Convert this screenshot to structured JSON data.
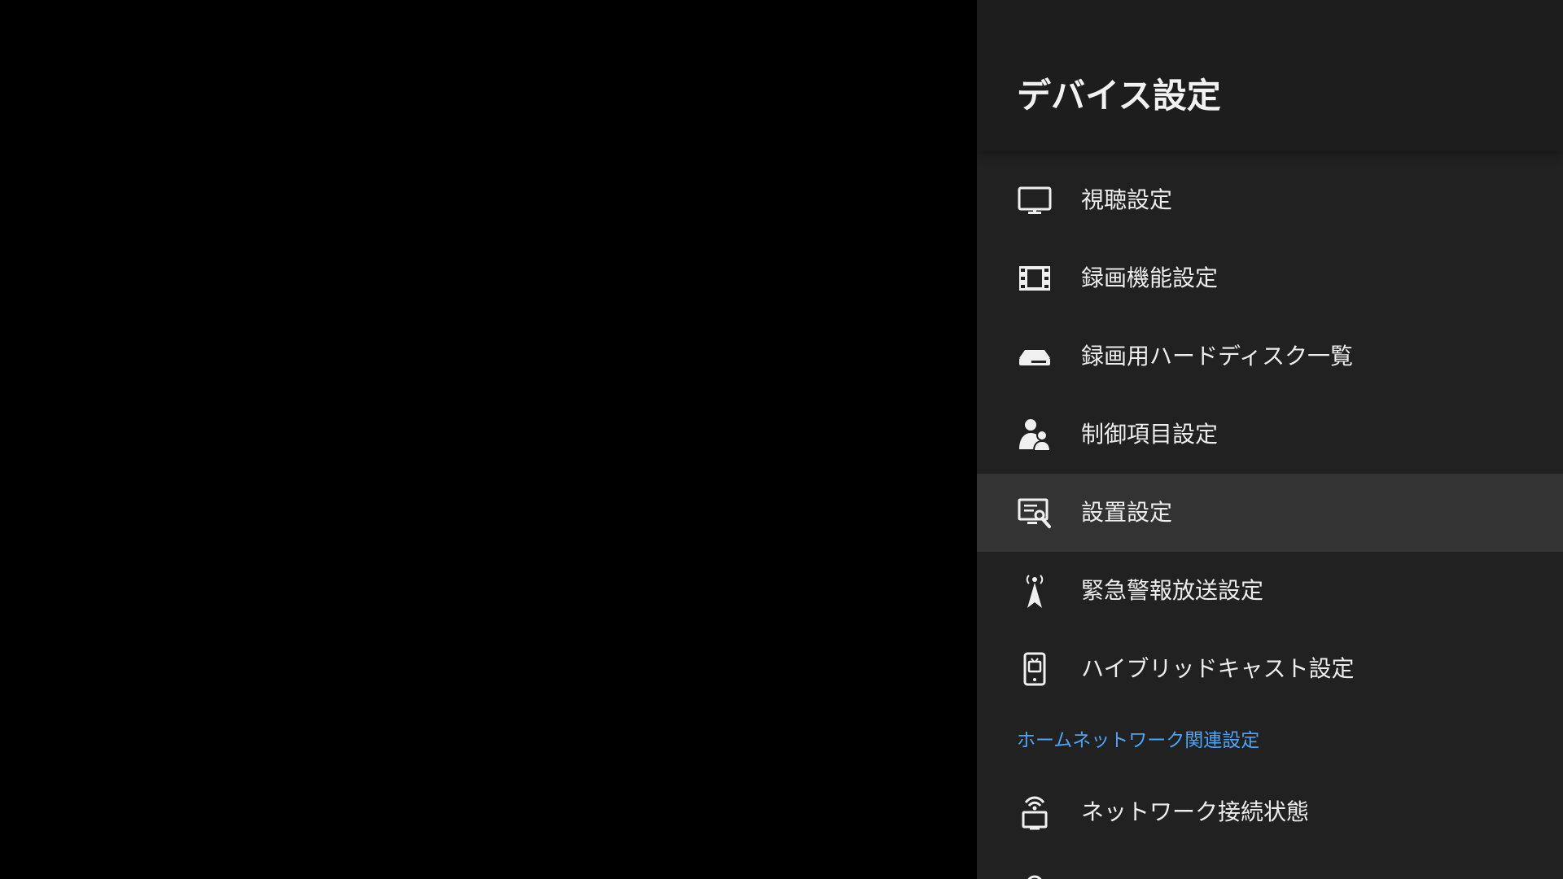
{
  "panel": {
    "title": "デバイス設定"
  },
  "menu": {
    "items": [
      {
        "label": "視聴設定",
        "icon": "tv-monitor-icon"
      },
      {
        "label": "録画機能設定",
        "icon": "film-strip-icon"
      },
      {
        "label": "録画用ハードディスク一覧",
        "icon": "hard-disk-icon"
      },
      {
        "label": "制御項目設定",
        "icon": "parental-control-users-icon"
      },
      {
        "label": "設置設定",
        "icon": "setup-screen-wrench-icon"
      },
      {
        "label": "緊急警報放送設定",
        "icon": "broadcast-tower-icon"
      },
      {
        "label": "ハイブリッドキャスト設定",
        "icon": "hybridcast-phone-icon"
      }
    ],
    "section": "ホームネットワーク関連設定",
    "network_items": [
      {
        "label": "ネットワーク接続状態",
        "icon": "network-wifi-tv-icon"
      }
    ]
  },
  "focused_index": 4,
  "colors": {
    "background": "#000000",
    "panel": "#212121",
    "focus": "#333333",
    "accent": "#4da3f5",
    "text": "#ededed"
  }
}
